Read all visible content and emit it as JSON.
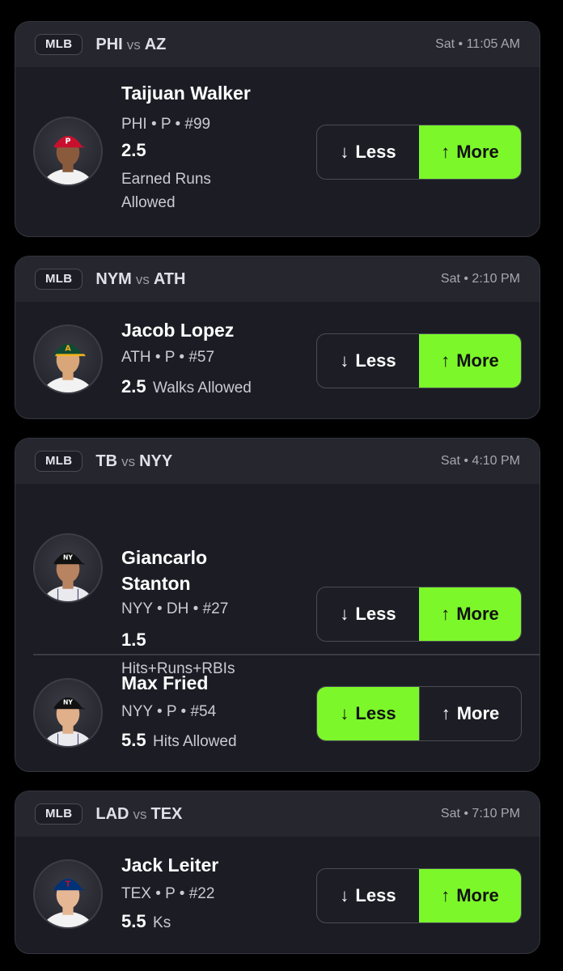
{
  "cards": [
    {
      "league": "MLB",
      "home": "PHI",
      "vs": "vs",
      "away": "AZ",
      "time": "Sat • 11:05 AM",
      "picks": [
        {
          "name": "Taijuan Walker",
          "meta": "PHI • P • #99",
          "line": "2.5",
          "stat": "Earned Runs Allowed",
          "less": "Less",
          "more": "More",
          "selected": "more",
          "cap_color": "#c8102e",
          "cap_logo": "P"
        }
      ]
    },
    {
      "league": "MLB",
      "home": "NYM",
      "vs": "vs",
      "away": "ATH",
      "time": "Sat • 2:10 PM",
      "picks": [
        {
          "name": "Jacob Lopez",
          "meta": "ATH • P • #57",
          "line": "2.5",
          "stat": "Walks Allowed",
          "less": "Less",
          "more": "More",
          "selected": "more",
          "cap_color": "#0f4a33",
          "cap_logo": "A"
        }
      ]
    },
    {
      "league": "MLB",
      "home": "TB",
      "vs": "vs",
      "away": "NYY",
      "time": "Sat • 4:10 PM",
      "picks": [
        {
          "name": "Giancarlo Stanton",
          "meta": "NYY • DH • #27",
          "line": "1.5",
          "stat": "Hits+Runs+RBIs",
          "less": "Less",
          "more": "More",
          "selected": "more",
          "cap_color": "#111111",
          "cap_logo": "NY"
        },
        {
          "name": "Max Fried",
          "meta": "NYY • P • #54",
          "line": "5.5",
          "stat": "Hits Allowed",
          "less": "Less",
          "more": "More",
          "selected": "less",
          "cap_color": "#111111",
          "cap_logo": "NY"
        }
      ]
    },
    {
      "league": "MLB",
      "home": "LAD",
      "vs": "vs",
      "away": "TEX",
      "time": "Sat • 7:10 PM",
      "picks": [
        {
          "name": "Jack Leiter",
          "meta": "TEX • P • #22",
          "line": "5.5",
          "stat": "Ks",
          "less": "Less",
          "more": "More",
          "selected": "more",
          "cap_color": "#003278",
          "cap_logo": "T"
        }
      ]
    }
  ],
  "icons": {
    "less": "arrow-down-icon",
    "more": "arrow-up-icon"
  },
  "colors": {
    "selected": "#7cf82a",
    "card_bg": "#1c1d24",
    "header_bg": "#25262e"
  }
}
